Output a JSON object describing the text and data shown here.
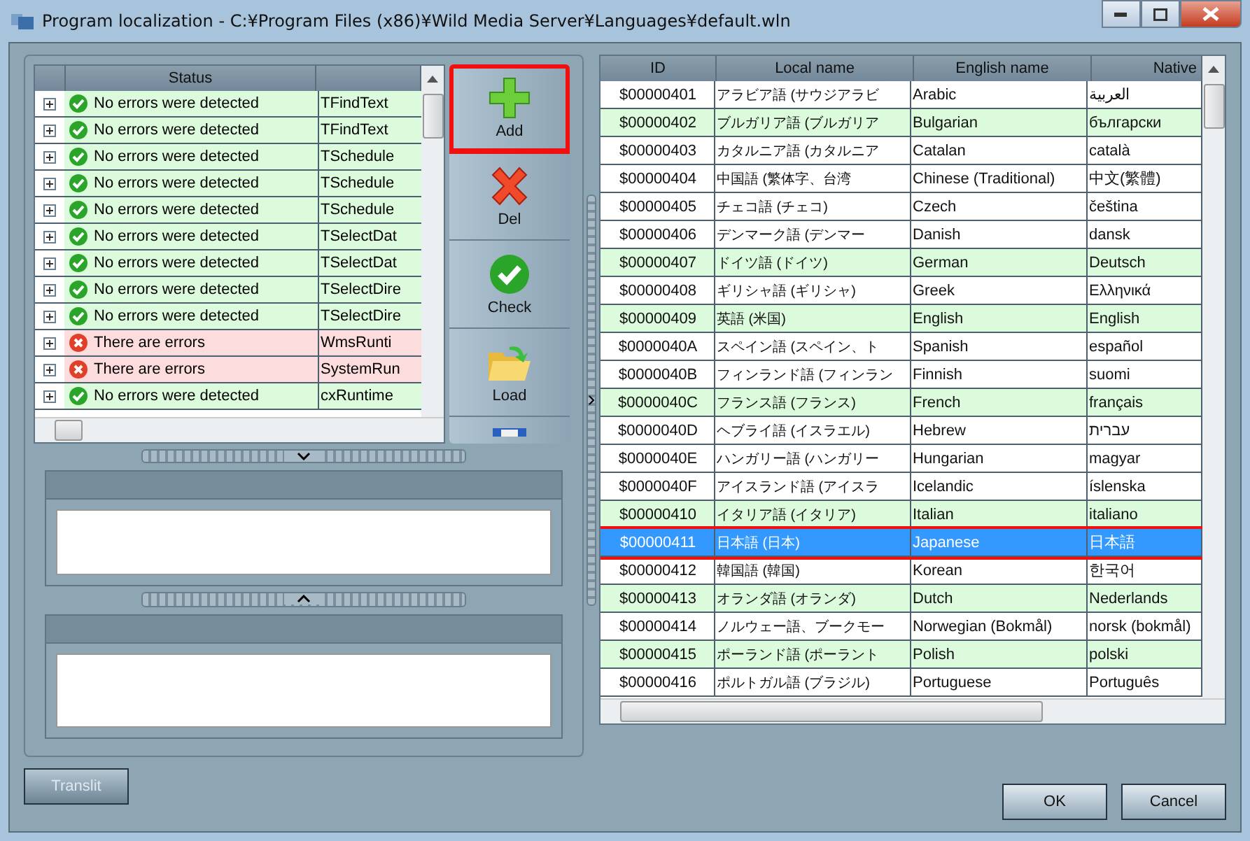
{
  "window": {
    "title": "Program localization - C:¥Program Files (x86)¥Wild Media Server¥Languages¥default.wln"
  },
  "check_grid": {
    "columns": [
      "Status"
    ],
    "rows": [
      {
        "status": "No errors were detected",
        "kind": "ok",
        "name": "TFindText"
      },
      {
        "status": "No errors were detected",
        "kind": "ok",
        "name": "TFindText"
      },
      {
        "status": "No errors were detected",
        "kind": "ok",
        "name": "TSchedule"
      },
      {
        "status": "No errors were detected",
        "kind": "ok",
        "name": "TSchedule"
      },
      {
        "status": "No errors were detected",
        "kind": "ok",
        "name": "TSchedule"
      },
      {
        "status": "No errors were detected",
        "kind": "ok",
        "name": "TSelectDat"
      },
      {
        "status": "No errors were detected",
        "kind": "ok",
        "name": "TSelectDat"
      },
      {
        "status": "No errors were detected",
        "kind": "ok",
        "name": "TSelectDire"
      },
      {
        "status": "No errors were detected",
        "kind": "ok",
        "name": "TSelectDire"
      },
      {
        "status": "There are errors",
        "kind": "error",
        "name": "WmsRunti"
      },
      {
        "status": "There are errors",
        "kind": "error",
        "name": "SystemRun"
      },
      {
        "status": "No errors were detected",
        "kind": "ok",
        "name": "cxRuntime"
      }
    ]
  },
  "toolbar": [
    {
      "label": "Add",
      "kind": "add",
      "highlighted": true
    },
    {
      "label": "Del",
      "kind": "delete",
      "highlighted": false
    },
    {
      "label": "Check",
      "kind": "check",
      "highlighted": false
    },
    {
      "label": "Load",
      "kind": "load",
      "highlighted": false
    }
  ],
  "language_grid": {
    "columns": [
      "ID",
      "Local name",
      "English name",
      "Native"
    ],
    "rows": [
      {
        "id": "$00000401",
        "local": "アラビア語 (サウジアラビ",
        "english": "Arabic",
        "native": "العربية",
        "marked": false,
        "selected": false
      },
      {
        "id": "$00000402",
        "local": "ブルガリア語 (ブルガリア",
        "english": "Bulgarian",
        "native": "български",
        "marked": true,
        "selected": false
      },
      {
        "id": "$00000403",
        "local": "カタルニア語 (カタルニア",
        "english": "Catalan",
        "native": "català",
        "marked": false,
        "selected": false
      },
      {
        "id": "$00000404",
        "local": "中国語 (繁体字、台湾",
        "english": "Chinese (Traditional)",
        "native": "中文(繁體)",
        "marked": false,
        "selected": false
      },
      {
        "id": "$00000405",
        "local": "チェコ語 (チェコ)",
        "english": "Czech",
        "native": "čeština",
        "marked": false,
        "selected": false
      },
      {
        "id": "$00000406",
        "local": "デンマーク語 (デンマー",
        "english": "Danish",
        "native": "dansk",
        "marked": false,
        "selected": false
      },
      {
        "id": "$00000407",
        "local": "ドイツ語 (ドイツ)",
        "english": "German",
        "native": "Deutsch",
        "marked": true,
        "selected": false
      },
      {
        "id": "$00000408",
        "local": "ギリシャ語 (ギリシャ)",
        "english": "Greek",
        "native": "Ελληνικά",
        "marked": false,
        "selected": false
      },
      {
        "id": "$00000409",
        "local": "英語 (米国)",
        "english": "English",
        "native": "English",
        "marked": true,
        "selected": false
      },
      {
        "id": "$0000040A",
        "local": "スペイン語 (スペイン、ト",
        "english": "Spanish",
        "native": "español",
        "marked": false,
        "selected": false
      },
      {
        "id": "$0000040B",
        "local": "フィンランド語 (フィンラン",
        "english": "Finnish",
        "native": "suomi",
        "marked": false,
        "selected": false
      },
      {
        "id": "$0000040C",
        "local": "フランス語 (フランス)",
        "english": "French",
        "native": "français",
        "marked": true,
        "selected": false
      },
      {
        "id": "$0000040D",
        "local": "ヘブライ語 (イスラエル)",
        "english": "Hebrew",
        "native": "עברית",
        "marked": false,
        "selected": false
      },
      {
        "id": "$0000040E",
        "local": "ハンガリー語 (ハンガリー",
        "english": "Hungarian",
        "native": "magyar",
        "marked": false,
        "selected": false
      },
      {
        "id": "$0000040F",
        "local": "アイスランド語 (アイスラ",
        "english": "Icelandic",
        "native": "íslenska",
        "marked": false,
        "selected": false
      },
      {
        "id": "$00000410",
        "local": "イタリア語 (イタリア)",
        "english": "Italian",
        "native": "italiano",
        "marked": true,
        "selected": false
      },
      {
        "id": "$00000411",
        "local": "日本語 (日本)",
        "english": "Japanese",
        "native": "日本語",
        "marked": false,
        "selected": true
      },
      {
        "id": "$00000412",
        "local": "韓国語 (韓国)",
        "english": "Korean",
        "native": "한국어",
        "marked": false,
        "selected": false
      },
      {
        "id": "$00000413",
        "local": "オランダ語 (オランダ)",
        "english": "Dutch",
        "native": "Nederlands",
        "marked": true,
        "selected": false
      },
      {
        "id": "$00000414",
        "local": "ノルウェー語、ブークモー",
        "english": "Norwegian (Bokmål)",
        "native": "norsk (bokmål)",
        "marked": false,
        "selected": false
      },
      {
        "id": "$00000415",
        "local": "ポーランド語 (ポーラント",
        "english": "Polish",
        "native": "polski",
        "marked": true,
        "selected": false
      },
      {
        "id": "$00000416",
        "local": "ポルトガル語 (ブラジル)",
        "english": "Portuguese",
        "native": "Português",
        "marked": false,
        "selected": false
      }
    ]
  },
  "buttons": {
    "translit": "Translit",
    "ok": "OK",
    "cancel": "Cancel"
  }
}
